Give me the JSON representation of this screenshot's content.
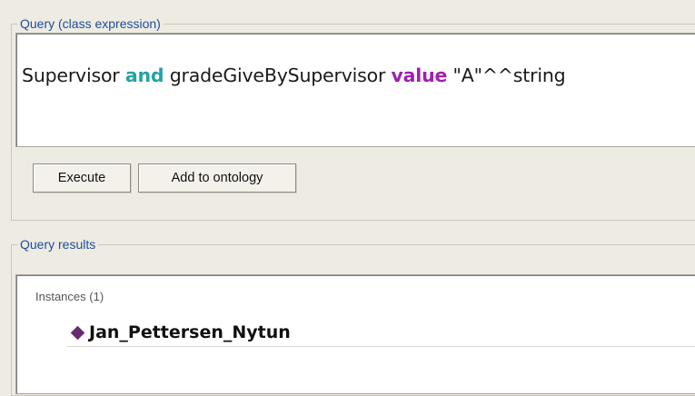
{
  "query_panel": {
    "title": "Query (class expression)",
    "expression": {
      "part1": "Supervisor ",
      "keyword_and": "and",
      "part2": " gradeGiveBySupervisor ",
      "keyword_value": "value",
      "part3": " \"A\"^^string"
    },
    "colors": {
      "and_keyword": "#22a3a5",
      "value_keyword": "#a020b0"
    },
    "buttons": {
      "execute": "Execute",
      "add_to_ontology": "Add to ontology"
    }
  },
  "results_panel": {
    "title": "Query results",
    "section_header": "Instances (1)",
    "instances": [
      {
        "name": "Jan_Pettersen_Nytun",
        "icon": "individual-diamond-icon"
      }
    ]
  }
}
